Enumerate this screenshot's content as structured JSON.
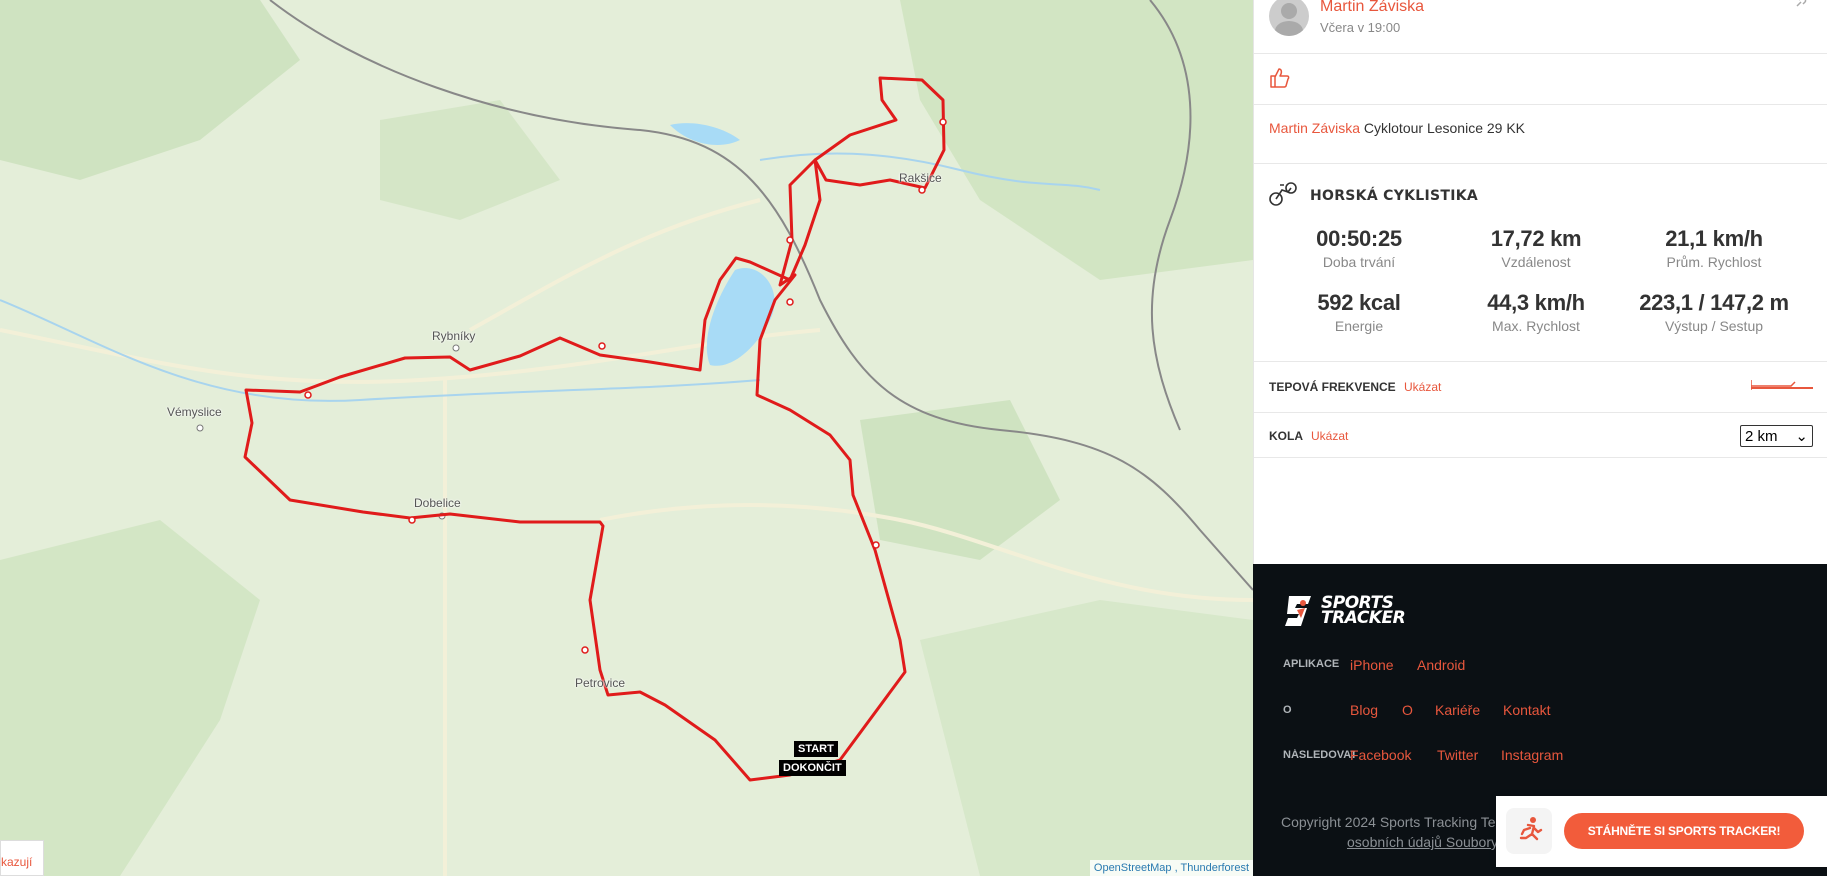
{
  "map": {
    "places": [
      {
        "name": "Vémyslice"
      },
      {
        "name": "Rybníky"
      },
      {
        "name": "Dobelice"
      },
      {
        "name": "Petrovice"
      },
      {
        "name": "Rakšice"
      }
    ],
    "start_label": "START",
    "finish_label": "DOKONČIT",
    "attribution": "OpenStreetMap , Thunderforest",
    "left_link": "kazují",
    "route_color": "#e01b1b"
  },
  "post": {
    "user_name": "Martin Záviska",
    "time": "Včera v 19:00",
    "desc_name": "Martin Záviska",
    "desc_text": "Cyklotour Lesonice 29 KK"
  },
  "workout": {
    "sport": "HORSKÁ CYKLISTIKA",
    "stats": [
      {
        "value": "00:50:25",
        "label": "Doba trvání"
      },
      {
        "value": "17,72  km",
        "label": "Vzdálenost"
      },
      {
        "value": "21,1  km/h",
        "label": "Prům. Rychlost"
      },
      {
        "value": "592 kcal",
        "label": "Energie"
      },
      {
        "value": "44,3  km/h",
        "label": "Max. Rychlost"
      },
      {
        "value": "223,1 / 147,2  m",
        "label": "Výstup / Sestup"
      }
    ]
  },
  "heart_rate": {
    "title": "TEPOVÁ FREKVENCE",
    "link": "Ukázat"
  },
  "laps": {
    "title": "KOLA",
    "link": "Ukázat",
    "selected": "2 km"
  },
  "footer": {
    "logo_line1": "SPORTS",
    "logo_line2": "TRACKER",
    "apps_label": "APLIKACE",
    "apps": [
      "iPhone",
      "Android"
    ],
    "about_label": "O",
    "about": [
      "Blog",
      "O",
      "Kariéře",
      "Kontakt"
    ],
    "follow_label": "NÁSLEDOVAT",
    "follow": [
      "Facebook",
      "Twitter",
      "Instagram"
    ],
    "copyright": "Copyright 2024 Sports Tracking Te",
    "privacy": "osobních údajů Soubory"
  },
  "download": {
    "button": "STÁHNĚTE SI SPORTS TRACKER!"
  },
  "colors": {
    "accent": "#e8573d",
    "footer_bg": "#0b1014"
  }
}
